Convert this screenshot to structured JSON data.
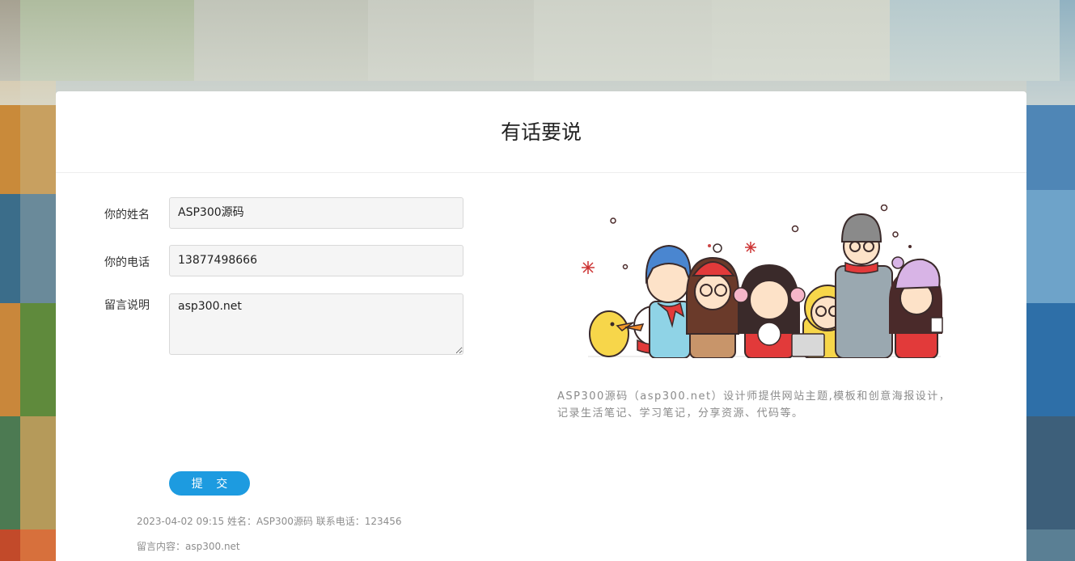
{
  "page": {
    "title": "有话要说"
  },
  "form": {
    "name_label": "你的姓名",
    "name_value": "ASP300源码",
    "phone_label": "你的电话",
    "phone_value": "13877498666",
    "message_label": "留言说明",
    "message_value": "asp300.net",
    "submit_label": "提 交"
  },
  "messages": [
    {
      "meta": "2023-04-02 09:15 姓名：ASP300源码 联系电话：123456",
      "content": "留言内容：asp300.net"
    }
  ],
  "sidebar": {
    "illustration": "cartoon-group-winter-illustration",
    "description": "ASP300源码（asp300.net）设计师提供网站主题,模板和创意海报设计，记录生活笔记、学习笔记，分享资源、代码等。"
  },
  "colors": {
    "accent": "#1d9be0",
    "card_bg": "#ffffff",
    "field_bg": "#f5f5f5",
    "muted_text": "#8d8d8d"
  }
}
